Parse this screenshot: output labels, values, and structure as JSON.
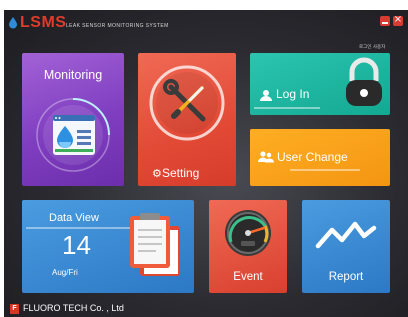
{
  "app": {
    "name": "LSMS",
    "subtitle": "LEAK SENSOR MONITORING SYSTEM",
    "user_line": "로그인 사용자"
  },
  "window_controls": {
    "minimize_glyph": "",
    "close_glyph": "×"
  },
  "tiles": {
    "monitoring": {
      "label": "Monitoring",
      "color": "#8a4bc9"
    },
    "setting": {
      "label": "Setting",
      "icon_glyph": "⚙",
      "color": "#e24a36"
    },
    "login": {
      "label": "Log In",
      "color": "#1fb39d"
    },
    "user_change": {
      "label": "User Change",
      "color": "#f7a01b"
    },
    "data_view": {
      "label": "Data View",
      "day": "14",
      "date": "Aug/Fri",
      "color": "#3a8ad3"
    },
    "event": {
      "label": "Event",
      "color": "#e24a36"
    },
    "report": {
      "label": "Report",
      "color": "#3a8ad3"
    }
  },
  "footer": {
    "badge": "F",
    "company": "FLUORO TECH Co. , Ltd"
  },
  "icons": [
    "water-drop-icon",
    "wrench-screwdriver-icon",
    "user-icon",
    "padlock-icon",
    "user-group-icon",
    "calendar-pages-icon",
    "gauge-icon",
    "trend-line-icon",
    "gear-icon"
  ]
}
